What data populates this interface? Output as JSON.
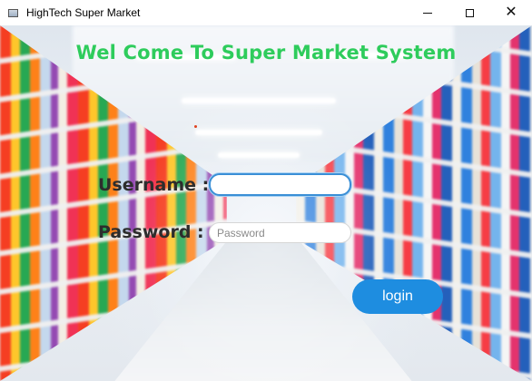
{
  "window": {
    "title": "HighTech Super Market",
    "icon": "app-window-icon",
    "controls": {
      "minimize_icon": "minimize-icon",
      "maximize_icon": "maximize-icon",
      "close_icon": "close-icon",
      "close_glyph": "✕"
    }
  },
  "main": {
    "heading": "Wel Come To Super Market System",
    "username_label": "Username :",
    "username_value": "",
    "password_label": "Password :",
    "password_placeholder": "Password",
    "password_value": "",
    "login_label": "login"
  },
  "colors": {
    "heading": "#2ecc5c",
    "button": "#1e8de0",
    "username_focus_border": "#3a8fd6"
  },
  "background": {
    "description_icon": "supermarket-aisle-background"
  }
}
